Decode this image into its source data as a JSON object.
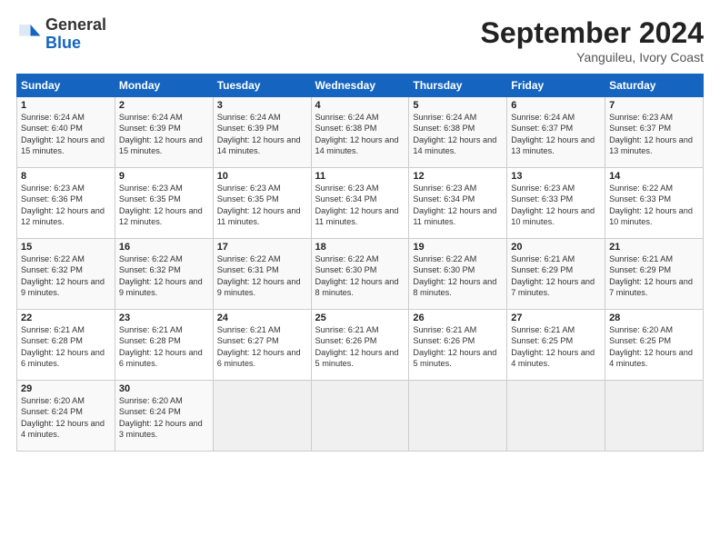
{
  "logo": {
    "general": "General",
    "blue": "Blue"
  },
  "header": {
    "month": "September 2024",
    "location": "Yanguileu, Ivory Coast"
  },
  "weekdays": [
    "Sunday",
    "Monday",
    "Tuesday",
    "Wednesday",
    "Thursday",
    "Friday",
    "Saturday"
  ],
  "weeks": [
    [
      {
        "day": "1",
        "sunrise": "6:24 AM",
        "sunset": "6:40 PM",
        "daylight": "12 hours and 15 minutes."
      },
      {
        "day": "2",
        "sunrise": "6:24 AM",
        "sunset": "6:39 PM",
        "daylight": "12 hours and 15 minutes."
      },
      {
        "day": "3",
        "sunrise": "6:24 AM",
        "sunset": "6:39 PM",
        "daylight": "12 hours and 14 minutes."
      },
      {
        "day": "4",
        "sunrise": "6:24 AM",
        "sunset": "6:38 PM",
        "daylight": "12 hours and 14 minutes."
      },
      {
        "day": "5",
        "sunrise": "6:24 AM",
        "sunset": "6:38 PM",
        "daylight": "12 hours and 14 minutes."
      },
      {
        "day": "6",
        "sunrise": "6:24 AM",
        "sunset": "6:37 PM",
        "daylight": "12 hours and 13 minutes."
      },
      {
        "day": "7",
        "sunrise": "6:23 AM",
        "sunset": "6:37 PM",
        "daylight": "12 hours and 13 minutes."
      }
    ],
    [
      {
        "day": "8",
        "sunrise": "6:23 AM",
        "sunset": "6:36 PM",
        "daylight": "12 hours and 12 minutes."
      },
      {
        "day": "9",
        "sunrise": "6:23 AM",
        "sunset": "6:35 PM",
        "daylight": "12 hours and 12 minutes."
      },
      {
        "day": "10",
        "sunrise": "6:23 AM",
        "sunset": "6:35 PM",
        "daylight": "12 hours and 11 minutes."
      },
      {
        "day": "11",
        "sunrise": "6:23 AM",
        "sunset": "6:34 PM",
        "daylight": "12 hours and 11 minutes."
      },
      {
        "day": "12",
        "sunrise": "6:23 AM",
        "sunset": "6:34 PM",
        "daylight": "12 hours and 11 minutes."
      },
      {
        "day": "13",
        "sunrise": "6:23 AM",
        "sunset": "6:33 PM",
        "daylight": "12 hours and 10 minutes."
      },
      {
        "day": "14",
        "sunrise": "6:22 AM",
        "sunset": "6:33 PM",
        "daylight": "12 hours and 10 minutes."
      }
    ],
    [
      {
        "day": "15",
        "sunrise": "6:22 AM",
        "sunset": "6:32 PM",
        "daylight": "12 hours and 9 minutes."
      },
      {
        "day": "16",
        "sunrise": "6:22 AM",
        "sunset": "6:32 PM",
        "daylight": "12 hours and 9 minutes."
      },
      {
        "day": "17",
        "sunrise": "6:22 AM",
        "sunset": "6:31 PM",
        "daylight": "12 hours and 9 minutes."
      },
      {
        "day": "18",
        "sunrise": "6:22 AM",
        "sunset": "6:30 PM",
        "daylight": "12 hours and 8 minutes."
      },
      {
        "day": "19",
        "sunrise": "6:22 AM",
        "sunset": "6:30 PM",
        "daylight": "12 hours and 8 minutes."
      },
      {
        "day": "20",
        "sunrise": "6:21 AM",
        "sunset": "6:29 PM",
        "daylight": "12 hours and 7 minutes."
      },
      {
        "day": "21",
        "sunrise": "6:21 AM",
        "sunset": "6:29 PM",
        "daylight": "12 hours and 7 minutes."
      }
    ],
    [
      {
        "day": "22",
        "sunrise": "6:21 AM",
        "sunset": "6:28 PM",
        "daylight": "12 hours and 6 minutes."
      },
      {
        "day": "23",
        "sunrise": "6:21 AM",
        "sunset": "6:28 PM",
        "daylight": "12 hours and 6 minutes."
      },
      {
        "day": "24",
        "sunrise": "6:21 AM",
        "sunset": "6:27 PM",
        "daylight": "12 hours and 6 minutes."
      },
      {
        "day": "25",
        "sunrise": "6:21 AM",
        "sunset": "6:26 PM",
        "daylight": "12 hours and 5 minutes."
      },
      {
        "day": "26",
        "sunrise": "6:21 AM",
        "sunset": "6:26 PM",
        "daylight": "12 hours and 5 minutes."
      },
      {
        "day": "27",
        "sunrise": "6:21 AM",
        "sunset": "6:25 PM",
        "daylight": "12 hours and 4 minutes."
      },
      {
        "day": "28",
        "sunrise": "6:20 AM",
        "sunset": "6:25 PM",
        "daylight": "12 hours and 4 minutes."
      }
    ],
    [
      {
        "day": "29",
        "sunrise": "6:20 AM",
        "sunset": "6:24 PM",
        "daylight": "12 hours and 4 minutes."
      },
      {
        "day": "30",
        "sunrise": "6:20 AM",
        "sunset": "6:24 PM",
        "daylight": "12 hours and 3 minutes."
      },
      null,
      null,
      null,
      null,
      null
    ]
  ]
}
